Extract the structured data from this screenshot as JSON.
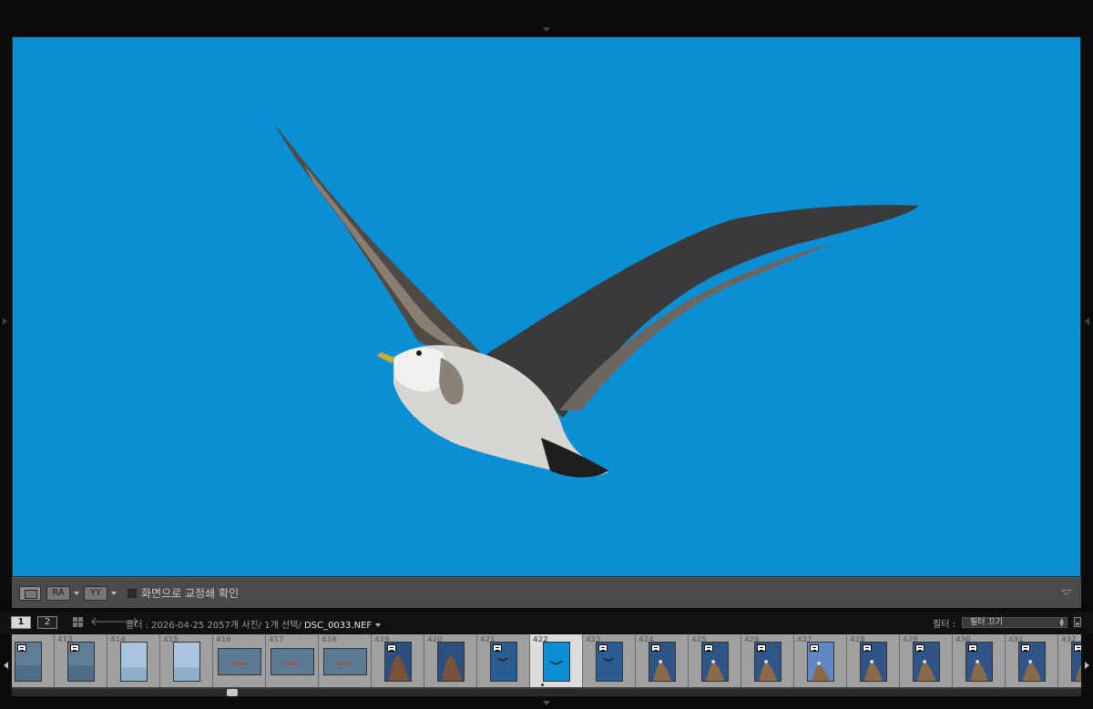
{
  "toolbar": {
    "compare_label": "RA",
    "survey_label": "YY",
    "softproof_label": "화면으로 교정쇄 확인"
  },
  "filmbar": {
    "screen1": "1",
    "screen2": "2",
    "folder_prefix": "폴더 : 2026-04-25",
    "photo_count": "2057개 사진/",
    "selected_count": "1개 선택/",
    "filename": "DSC_0033.NEF",
    "filter_label": "필터 :",
    "filter_value": "필터 끄기"
  },
  "filmstrip": {
    "cells": [
      {
        "num": "",
        "kind": "port",
        "scene": "sea",
        "badge": true
      },
      {
        "num": "413",
        "kind": "port",
        "scene": "sea",
        "badge": true
      },
      {
        "num": "414",
        "kind": "port",
        "scene": "haze",
        "badge": false
      },
      {
        "num": "415",
        "kind": "port",
        "scene": "haze",
        "badge": false
      },
      {
        "num": "416",
        "kind": "land",
        "scene": "boat",
        "badge": false
      },
      {
        "num": "417",
        "kind": "land",
        "scene": "boat",
        "badge": false
      },
      {
        "num": "418",
        "kind": "land",
        "scene": "boat",
        "badge": false
      },
      {
        "num": "419",
        "kind": "port",
        "scene": "rock",
        "badge": true
      },
      {
        "num": "420",
        "kind": "port",
        "scene": "rock",
        "badge": false
      },
      {
        "num": "421",
        "kind": "port",
        "scene": "bird",
        "badge": true
      },
      {
        "num": "422",
        "kind": "port",
        "scene": "sky",
        "badge": false,
        "selected": true
      },
      {
        "num": "423",
        "kind": "port",
        "scene": "bird",
        "badge": true
      },
      {
        "num": "424",
        "kind": "port",
        "scene": "gulls",
        "badge": true
      },
      {
        "num": "425",
        "kind": "port",
        "scene": "gulls",
        "badge": true
      },
      {
        "num": "426",
        "kind": "port",
        "scene": "gulls",
        "badge": true
      },
      {
        "num": "427",
        "kind": "port",
        "scene": "gulls2",
        "badge": true
      },
      {
        "num": "428",
        "kind": "port",
        "scene": "gulls",
        "badge": true
      },
      {
        "num": "429",
        "kind": "port",
        "scene": "gulls",
        "badge": true
      },
      {
        "num": "430",
        "kind": "port",
        "scene": "gulls",
        "badge": true
      },
      {
        "num": "431",
        "kind": "port",
        "scene": "gulls",
        "badge": true
      },
      {
        "num": "432",
        "kind": "port",
        "scene": "gulls",
        "badge": true
      }
    ]
  },
  "colors": {
    "sky": "#0a8fd4",
    "panel": "#4a4a4a"
  }
}
